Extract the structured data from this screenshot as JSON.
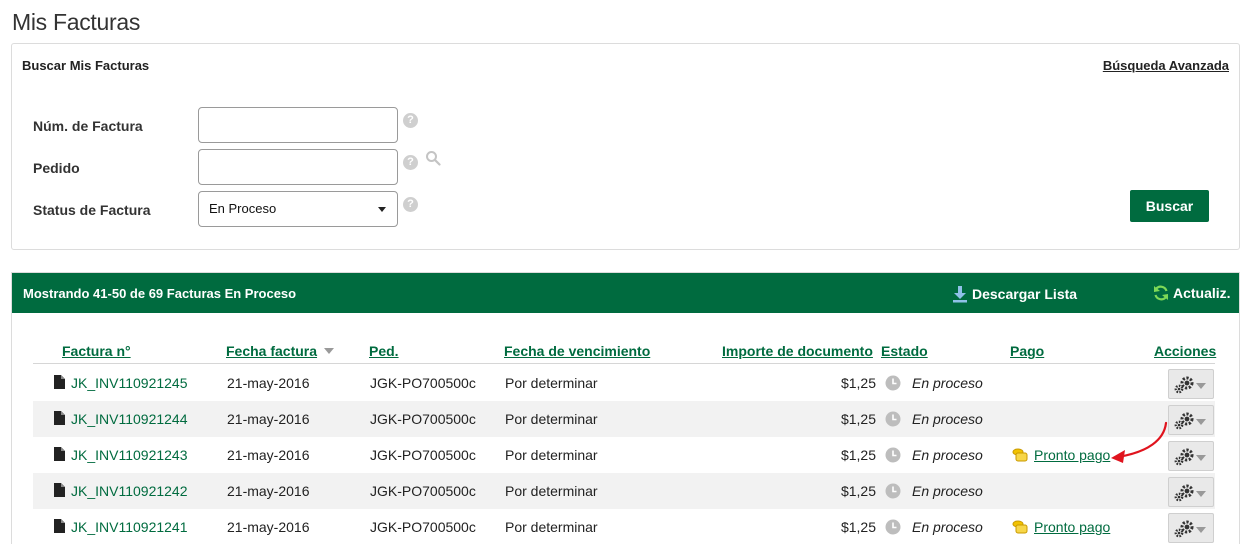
{
  "page": {
    "title": "Mis Facturas"
  },
  "search": {
    "title": "Buscar Mis Facturas",
    "advanced_link": "Búsqueda Avanzada",
    "fields": [
      {
        "label": "Núm. de Factura",
        "value": ""
      },
      {
        "label": "Pedido",
        "value": ""
      },
      {
        "label": "Status de Factura",
        "selected": "En Proceso"
      }
    ],
    "submit_label": "Buscar"
  },
  "results": {
    "summary": "Mostrando 41-50 de 69 Facturas En Proceso",
    "download_label": "Descargar Lista",
    "refresh_label": "Actualiz.",
    "columns": [
      "Factura n°",
      "Fecha factura",
      "Ped.",
      "Fecha de vencimiento",
      "Importe de documento",
      "Estado",
      "Pago",
      "Acciones"
    ],
    "rows": [
      {
        "invoice": "JK_INV110921245",
        "date": "21-may-2016",
        "order": "JGK-PO700500c",
        "due": "Por determinar",
        "amount": "$1,25",
        "status": "En proceso",
        "payment": ""
      },
      {
        "invoice": "JK_INV110921244",
        "date": "21-may-2016",
        "order": "JGK-PO700500c",
        "due": "Por determinar",
        "amount": "$1,25",
        "status": "En proceso",
        "payment": ""
      },
      {
        "invoice": "JK_INV110921243",
        "date": "21-may-2016",
        "order": "JGK-PO700500c",
        "due": "Por determinar",
        "amount": "$1,25",
        "status": "En proceso",
        "payment": "Pronto pago"
      },
      {
        "invoice": "JK_INV110921242",
        "date": "21-may-2016",
        "order": "JGK-PO700500c",
        "due": "Por determinar",
        "amount": "$1,25",
        "status": "En proceso",
        "payment": ""
      },
      {
        "invoice": "JK_INV110921241",
        "date": "21-may-2016",
        "order": "JGK-PO700500c",
        "due": "Por determinar",
        "amount": "$1,25",
        "status": "En proceso",
        "payment": "Pronto pago"
      }
    ]
  },
  "colors": {
    "brand_green": "#006b3f",
    "annotation_red": "#e0141e",
    "coin_gold": "#f2c200"
  },
  "icons": [
    "help-icon",
    "search-icon",
    "dropdown-caret-icon",
    "download-icon",
    "refresh-icon",
    "sort-desc-icon",
    "document-icon",
    "clock-icon",
    "coins-icon",
    "gear-icon"
  ]
}
